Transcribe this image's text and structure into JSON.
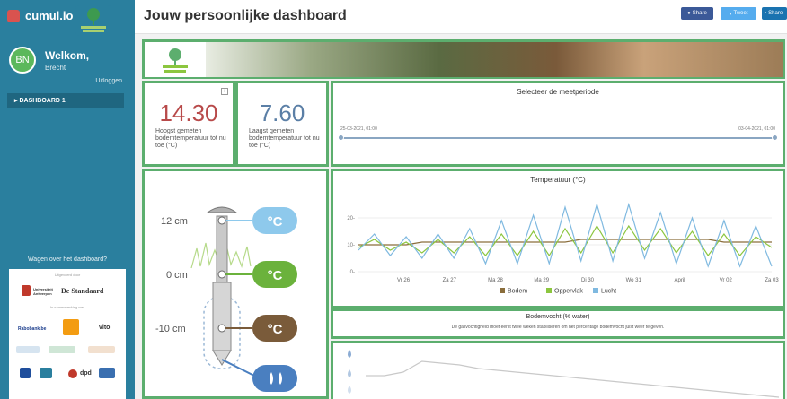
{
  "sidebar": {
    "brand": "cumul.io",
    "avatar": "BN",
    "welcome": "Welkom,",
    "user": "Brecht",
    "logout": "Uitloggen",
    "nav_item": "▸ DASHBOARD 1",
    "question": "Wagen over het dashboard?",
    "partners": {
      "caption1": "Uitgevoerd door",
      "uantwerpen": "Universiteit Antwerpen",
      "standaard": "De Standaard",
      "caption2": "In samenwerking met",
      "rabobank": "Rabobank.be",
      "vito": "vito",
      "dpd": "dpd"
    }
  },
  "header": {
    "title": "Jouw persoonlijke dashboard",
    "share_facebook": "Share",
    "share_twitter": "Tweet",
    "share_linkedin": "Share"
  },
  "stats": [
    {
      "value": "14.30",
      "label": "Hoogst gemeten bodemtemperatuur tot nu toe (°C)",
      "color": "#b84a4a"
    },
    {
      "value": "7.60",
      "label": "Laagst gemeten bodemtemperatuur tot nu toe (°C)",
      "color": "#5b7fa6"
    }
  ],
  "period": {
    "title": "Selecteer de meetperiode",
    "start": "25-03-2021, 01:00",
    "end": "03-04-2021, 01:00"
  },
  "probe": {
    "levels": [
      "12 cm",
      "0 cm",
      "-10 cm"
    ],
    "unit": "°C",
    "colors": {
      "air": "#8ec9ec",
      "surface": "#6bb23c",
      "soil": "#7a5b3a",
      "water": "#4a7fc0"
    }
  },
  "chart_data": {
    "type": "line",
    "title": "Temperatuur (°C)",
    "categories": [
      "Vr 26",
      "Za 27",
      "Ma 28",
      "Ma 29",
      "Di 30",
      "Wo 31",
      "April",
      "Vr 02",
      "Za 03"
    ],
    "ylim": [
      0,
      24
    ],
    "yticks": [
      0,
      10,
      20
    ],
    "series": [
      {
        "name": "Bodem",
        "color": "#8a6d3b",
        "values": [
          10,
          10,
          10,
          10,
          11,
          11,
          11,
          11,
          11,
          11,
          11,
          11,
          11,
          11,
          12,
          12,
          12,
          12,
          12,
          12,
          12,
          12,
          12,
          11,
          11,
          11,
          11
        ]
      },
      {
        "name": "Oppervlak",
        "color": "#8cc63f",
        "values": [
          9,
          12,
          8,
          11,
          7,
          12,
          7,
          13,
          6,
          14,
          6,
          15,
          6,
          16,
          7,
          17,
          7,
          17,
          8,
          16,
          7,
          15,
          6,
          14,
          6,
          13,
          9
        ]
      },
      {
        "name": "Lucht",
        "color": "#7fb9e0",
        "values": [
          8,
          14,
          6,
          13,
          5,
          14,
          5,
          16,
          3,
          19,
          3,
          21,
          3,
          24,
          4,
          25,
          4,
          25,
          5,
          22,
          3,
          20,
          2,
          19,
          2,
          17,
          2
        ]
      }
    ]
  },
  "moisture": {
    "title": "Bodemvocht (% water)",
    "subtitle": "De gasvochtigheid moet eerst twee weken stabiliseren om het percentage bodemvocht juist weer te geven."
  },
  "moisture_chart": {
    "values": [
      12,
      12,
      14,
      20,
      19,
      18,
      16,
      15,
      14,
      13,
      12,
      11,
      10,
      9,
      8,
      7,
      6,
      5,
      4,
      3,
      2,
      1,
      0
    ]
  }
}
